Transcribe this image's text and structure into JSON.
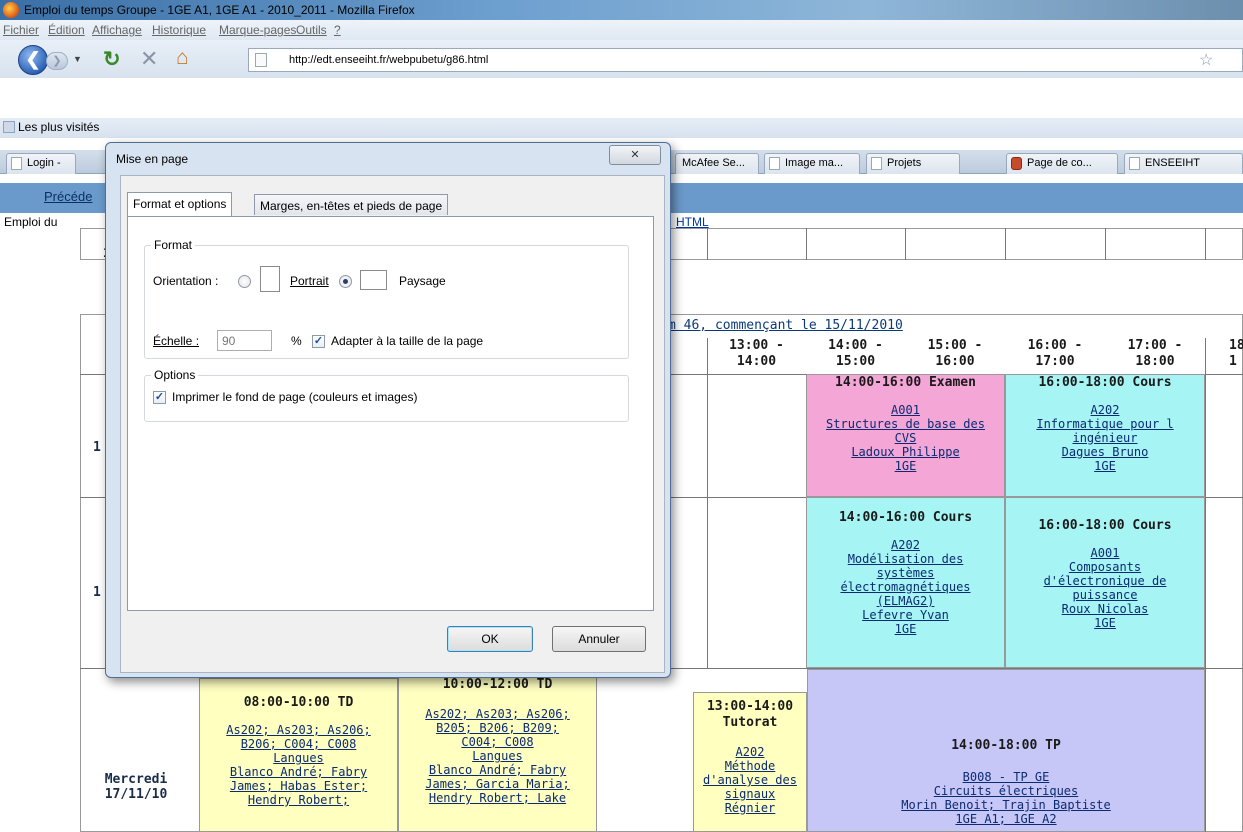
{
  "window": {
    "title": "Emploi du temps Groupe - 1GE A1, 1GE A1 - 2010_2011 - Mozilla Firefox"
  },
  "menu": [
    "Fichier",
    "Édition",
    "Affichage",
    "Historique",
    "Marque-pages",
    "Outils",
    "?"
  ],
  "toolbar": {
    "url": "http://edt.enseeiht.fr/webpubetu/g86.html"
  },
  "bookmarks": {
    "label": "Les plus visités"
  },
  "tabs": [
    {
      "label": "Login -"
    },
    {
      "label": "McAfee Se..."
    },
    {
      "label": "Image ma..."
    },
    {
      "label": "Projets"
    },
    {
      "label": "Page de co..."
    },
    {
      "label": "ENSEEIHT"
    }
  ],
  "page": {
    "prev_label": "Précéde",
    "title_partial": "Emploi du",
    "html_link": "HTML",
    "week_label": "m 46, commençant le 15/11/2010"
  },
  "timetable": {
    "headers": [
      {
        "line1": "13:00 -",
        "line2": "14:00"
      },
      {
        "line1": "14:00 -",
        "line2": "15:00"
      },
      {
        "line1": "15:00 -",
        "line2": "16:00"
      },
      {
        "line1": "16:00 -",
        "line2": "17:00"
      },
      {
        "line1": "17:00 -",
        "line2": "18:00"
      },
      {
        "line1": "18",
        "line2": "1"
      }
    ],
    "row_labels_partial": [
      "1",
      "1"
    ],
    "day3": {
      "label1": "Mercredi",
      "label2": "17/11/10"
    },
    "events": {
      "mon_exam": {
        "title": "14:00-16:00 Examen",
        "room": "A001",
        "course1": "Structures de base des",
        "course2": "CVS",
        "teacher": "Ladoux Philippe",
        "group": "1GE"
      },
      "mon_cours": {
        "title": "16:00-18:00 Cours",
        "room": "A202",
        "course1": "Informatique pour l",
        "course2": "ingénieur",
        "teacher": "Dagues Bruno",
        "group": "1GE"
      },
      "tue_cours1": {
        "title": "14:00-16:00 Cours",
        "room": "A202",
        "course1": "Modélisation des",
        "course2": "systèmes",
        "course3": "électromagnétiques",
        "course4": "(ELMAG2)",
        "teacher": "Lefevre Yvan",
        "group": "1GE"
      },
      "tue_cours2": {
        "title": "16:00-18:00 Cours",
        "room": "A001",
        "course1": "Composants",
        "course2": "d'électronique de",
        "course3": "puissance",
        "teacher": "Roux Nicolas",
        "group": "1GE"
      },
      "wed_td1": {
        "title": "08:00-10:00 TD",
        "rooms1": "As202; As203; As206;",
        "rooms2": "B206; C004; C008",
        "course": "Langues",
        "t1": "Blanco André; Fabry",
        "t2": "James; Habas Ester;",
        "t3": "Hendry Robert;"
      },
      "wed_td2": {
        "title": "10:00-12:00 TD",
        "rooms1": "As202; As203; As206;",
        "rooms2": "B205; B206; B209;",
        "rooms3": "C004; C008",
        "course": "Langues",
        "t1": "Blanco André; Fabry",
        "t2": "James; Garcia Maria;",
        "t3": "Hendry Robert; Lake"
      },
      "wed_tut": {
        "title1": "13:00-14:00",
        "title2": "Tutorat",
        "room": "A202",
        "c1": "Méthode",
        "c2": "d'analyse des",
        "c3": "signaux",
        "c4": "Régnier"
      },
      "wed_tp": {
        "title": "14:00-18:00 TP",
        "room": "B008 - TP GE",
        "course": "Circuits électriques",
        "teacher": "Morin Benoit; Trajin Baptiste",
        "group": "1GE A1; 1GE A2"
      }
    }
  },
  "dialog": {
    "title": "Mise en page",
    "tab_active": "Format et options",
    "tab_other": "Marges, en-têtes et pieds de page",
    "format_group": "Format",
    "orientation_label": "Orientation :",
    "portrait": "Portrait",
    "paysage": "Paysage",
    "scale_label": "Échelle :",
    "scale_value": "90",
    "percent": "%",
    "fit_label": "Adapter à la taille de la page",
    "options_group": "Options",
    "print_bg_label": "Imprimer le fond de page (couleurs et images)",
    "ok": "OK",
    "cancel": "Annuler",
    "close_glyph": "✕"
  },
  "colors": {
    "exam": "#f4a6d6",
    "cours": "#a6f4f4",
    "td": "#ffffc0",
    "tp": "#c7c7f7"
  }
}
